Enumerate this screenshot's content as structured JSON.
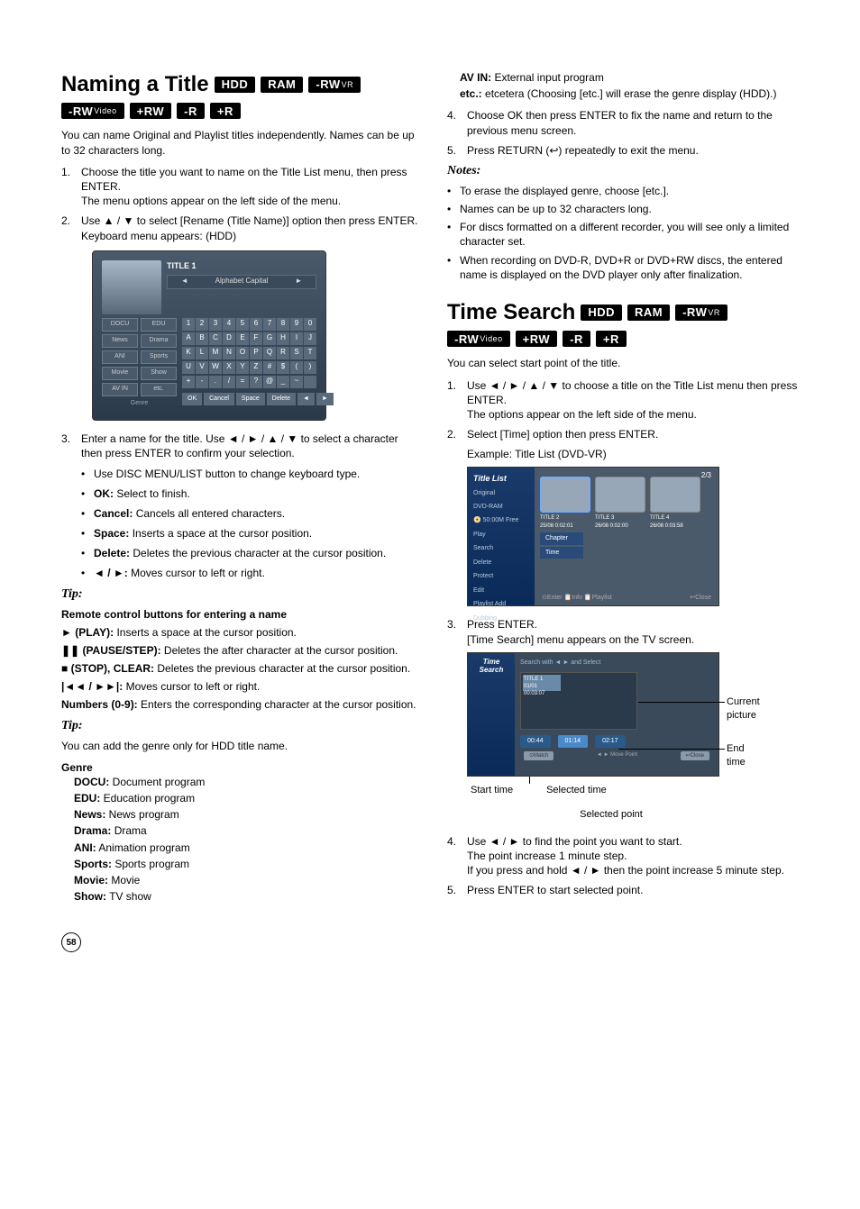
{
  "page_number": "58",
  "left": {
    "title": "Naming a Title",
    "badges1": [
      "HDD",
      "RAM"
    ],
    "badges1b": [
      {
        "main": "-RW",
        "sub": "VR"
      }
    ],
    "badges2": [
      {
        "main": "-RW",
        "sub": "Video"
      },
      {
        "main": "+RW",
        "sub": ""
      },
      {
        "main": "-R",
        "sub": ""
      },
      {
        "main": "+R",
        "sub": ""
      }
    ],
    "intro": "You can name Original and Playlist titles independently. Names can be up to 32 characters long.",
    "step1": "Choose the title you want to name on the Title List menu, then press ENTER.",
    "step1b": "The menu options appear on the left side of the menu.",
    "step2a": "Use ▲ / ▼ to select [Rename (Title Name)] option then press ENTER.",
    "step2b": "Keyboard menu appears: (HDD)",
    "kb": {
      "title": "TITLE 1",
      "subhead_left": "◄",
      "subhead_mid": "Alphabet Capital",
      "subhead_right": "►",
      "cats": [
        [
          "DOCU",
          "EDU"
        ],
        [
          "News",
          "Drama"
        ],
        [
          "ANI",
          "Sports"
        ],
        [
          "Movie",
          "Show"
        ],
        [
          "AV IN",
          "etc."
        ]
      ],
      "genre_label": "Genre",
      "rows": [
        [
          "1",
          "2",
          "3",
          "4",
          "5",
          "6",
          "7",
          "8",
          "9",
          "0"
        ],
        [
          "A",
          "B",
          "C",
          "D",
          "E",
          "F",
          "G",
          "H",
          "I",
          "J"
        ],
        [
          "K",
          "L",
          "M",
          "N",
          "O",
          "P",
          "Q",
          "R",
          "S",
          "T"
        ],
        [
          "U",
          "V",
          "W",
          "X",
          "Y",
          "Z",
          "#",
          "$",
          "(",
          ")"
        ],
        [
          "+",
          "-",
          ".",
          "/",
          "=",
          "?",
          "@",
          "_",
          "~",
          " "
        ]
      ],
      "bottom": [
        "OK",
        "Cancel",
        "Space",
        "Delete",
        "◄",
        "►"
      ]
    },
    "step3": "Enter a name for the title. Use ◄ / ► / ▲ / ▼ to select a character then press ENTER to confirm your selection.",
    "b1": "Use DISC MENU/LIST button to change keyboard type.",
    "b2_label": "OK:",
    "b2": " Select to finish.",
    "b3_label": "Cancel:",
    "b3": " Cancels all entered characters.",
    "b4_label": "Space:",
    "b4": " Inserts a space at the cursor position.",
    "b5_label": "Delete:",
    "b5": " Deletes the previous character at the cursor position.",
    "b6_label": "◄ / ►:",
    "b6": " Moves cursor to left or right.",
    "tip1_label": "Tip:",
    "tip1_head": "Remote control buttons for entering a name",
    "rc1_label": "► (PLAY):",
    "rc1": " Inserts a space at the cursor position.",
    "rc2_label": "❚❚ (PAUSE/STEP):",
    "rc2": " Deletes the after character at the cursor position.",
    "rc3_label": "■ (STOP), CLEAR:",
    "rc3": " Deletes the previous character at the cursor position.",
    "rc4_label": "|◄◄ / ►►|:",
    "rc4": " Moves cursor to left or right.",
    "rc5_label": "Numbers (0-9):",
    "rc5": " Enters the corresponding character at the cursor position.",
    "tip2_label": "Tip:",
    "tip2_body": "You can add the genre only for HDD title name.",
    "genre_head": "Genre",
    "genres": [
      {
        "k": "DOCU:",
        "v": " Document program"
      },
      {
        "k": "EDU:",
        "v": " Education program"
      },
      {
        "k": "News:",
        "v": " News program"
      },
      {
        "k": "Drama:",
        "v": " Drama"
      },
      {
        "k": "ANI:",
        "v": " Animation program"
      },
      {
        "k": "Sports:",
        "v": " Sports program"
      },
      {
        "k": "Movie:",
        "v": " Movie"
      },
      {
        "k": "Show:",
        "v": " TV show"
      }
    ]
  },
  "right": {
    "top": [
      {
        "k": "AV IN:",
        "v": " External input program"
      },
      {
        "k": "etc.:",
        "v": " etcetera (Choosing [etc.] will erase the genre display (HDD).)"
      }
    ],
    "step4": "Choose OK then press ENTER to fix the name and return to the previous menu screen.",
    "step5": "Press RETURN (↩) repeatedly to exit the menu.",
    "notes_label": "Notes:",
    "notes": [
      "To erase the displayed genre, choose [etc.].",
      "Names can be up to 32 characters long.",
      "For discs formatted on a different recorder, you will see only a limited character set.",
      "When recording on DVD-R, DVD+R or DVD+RW discs, the entered name is displayed on the DVD player only after finalization."
    ],
    "title": "Time Search",
    "badges1": [
      "HDD",
      "RAM"
    ],
    "badges1b": [
      {
        "main": "-RW",
        "sub": "VR"
      }
    ],
    "badges2": [
      {
        "main": "-RW",
        "sub": "Video"
      },
      {
        "main": "+RW",
        "sub": ""
      },
      {
        "main": "-R",
        "sub": ""
      },
      {
        "main": "+R",
        "sub": ""
      }
    ],
    "intro": "You can select start point of the title.",
    "step1": "Use ◄ / ► / ▲ / ▼ to choose a title on the Title List menu then press ENTER.",
    "step1b": "The options appear on the left side of the menu.",
    "step2": "Select [Time] option then press ENTER.",
    "step2b": "Example: Title List (DVD-VR)",
    "tl": {
      "side_title": "Title List",
      "side_items": [
        "Original",
        "DVD-RAM",
        "📀 50:00M Free",
        "Play",
        "Search",
        "Delete",
        "Protect",
        "Edit",
        "Playlist Add",
        "Dubbing"
      ],
      "sub": [
        "Chapter",
        "Time"
      ],
      "pager": "2/3",
      "thumbs": [
        {
          "t": "TITLE 2",
          "d": "25/08  0:02:01"
        },
        {
          "t": "TITLE 3",
          "d": "26/08  0:02:00"
        },
        {
          "t": "TITLE 4",
          "d": "26/08  0:03:58"
        }
      ],
      "foot_left": "⊙Enter 📋Info 📋Playlist",
      "foot_right": "↩Close"
    },
    "step3": "Press ENTER.",
    "step3b": "[Time Search] menu appears on the TV screen.",
    "ts": {
      "side": "Time Search",
      "hdr": "Search with ◄ ► and Select",
      "thumb_label": "TITLE 1",
      "thumb_time": "01/01  00:03:07",
      "times": [
        "00:44",
        "01:14",
        "02:17"
      ],
      "foot_left": "⊙Match",
      "foot_mid": "◄ ► Move Point",
      "foot_right": "↩Close",
      "call_current": "Current picture",
      "call_end": "End time",
      "lab_start": "Start time",
      "lab_selected": "Selected time",
      "lab_point": "Selected point"
    },
    "step4a": "Use ◄ / ► to find the point you want to start.",
    "step4b": "The point increase 1 minute step.",
    "step4c": "If you press and hold ◄ / ► then the point increase 5 minute step.",
    "step5b": "Press ENTER to start selected point."
  }
}
